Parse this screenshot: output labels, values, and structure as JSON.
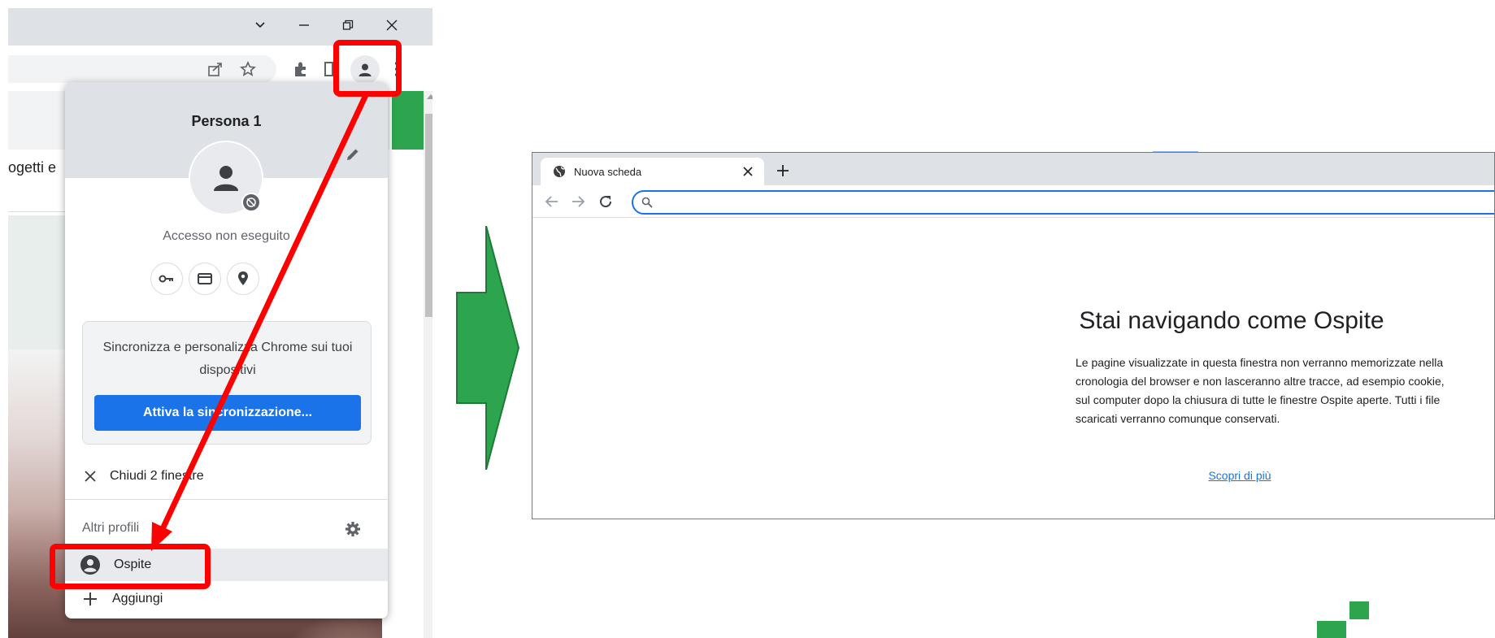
{
  "left_browser": {
    "page_text": "ogetti e",
    "titlebar": {
      "tabsearch_icon": "chevron-down-icon",
      "minimize_icon": "minimize-icon",
      "restore_icon": "restore-icon",
      "close_icon": "close-icon"
    },
    "toolbar_icons": [
      "share-icon",
      "star-icon",
      "extensions-icon",
      "side-panel-icon",
      "profile-icon",
      "more-vert-icon"
    ]
  },
  "profile_menu": {
    "title": "Persona 1",
    "status": "Accesso non eseguito",
    "quick_icons": [
      "key-icon",
      "card-icon",
      "location-icon"
    ],
    "sync_text": "Sincronizza e personalizza Chrome sui tuoi dispositivi",
    "sync_button": "Attiva la sincronizzazione...",
    "close_windows": "Chiudi 2 finestre",
    "other_profiles": "Altri profili",
    "guest": "Ospite",
    "add": "Aggiungi"
  },
  "guest_browser": {
    "tab_title": "Nuova scheda",
    "heading": "Stai navigando come Ospite",
    "description": "Le pagine visualizzate in questa finestra non verranno memorizzate nella cronologia del browser e non lasceranno altre tracce, ad esempio cookie, sul computer dopo la chiusura di tutte le finestre Ospite aperte. Tutti i file scaricati verranno comunque conservati.",
    "learn_more": "Scopri di più"
  },
  "colors": {
    "highlight_red": "#ff0000",
    "arrow_green": "#2da44e",
    "chrome_blue": "#1a73e8",
    "tab_gray": "#dee1e6"
  }
}
